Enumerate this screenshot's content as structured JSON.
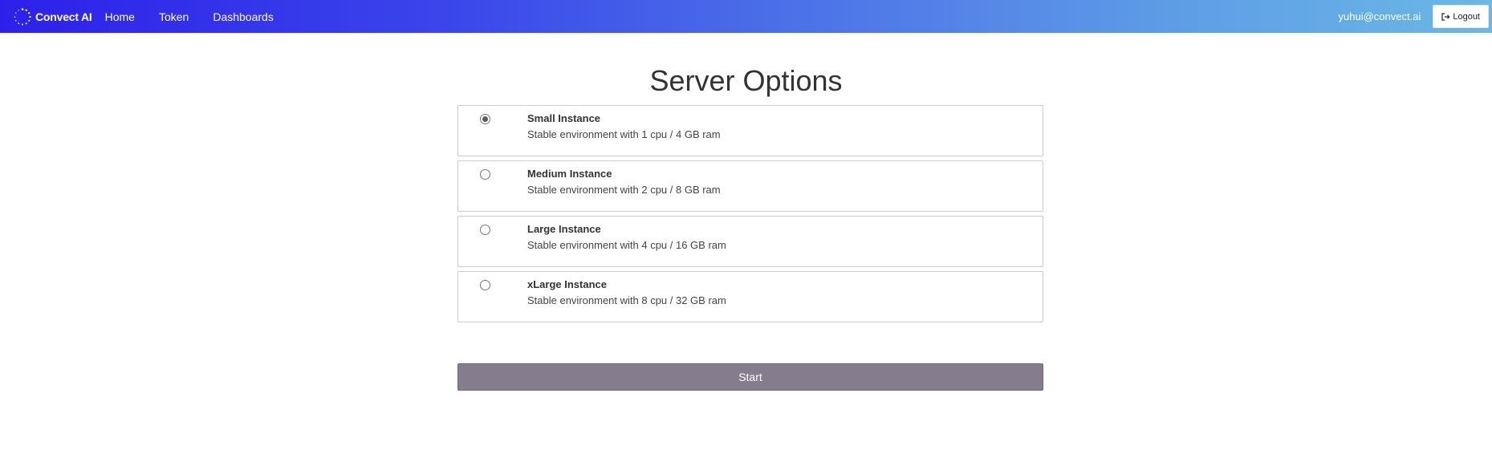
{
  "navbar": {
    "brand": "Convect AI",
    "links": [
      "Home",
      "Token",
      "Dashboards"
    ],
    "user_email": "yuhui@convect.ai",
    "logout_label": "Logout",
    "icons": {
      "brand": "spinner-logo-icon",
      "logout": "sign-out-icon"
    }
  },
  "main": {
    "title": "Server Options",
    "options": [
      {
        "name": "Small Instance",
        "description": "Stable environment with 1 cpu / 4 GB ram",
        "selected": true
      },
      {
        "name": "Medium Instance",
        "description": "Stable environment with 2 cpu / 8 GB ram",
        "selected": false
      },
      {
        "name": "Large Instance",
        "description": "Stable environment with 4 cpu / 16 GB ram",
        "selected": false
      },
      {
        "name": "xLarge Instance",
        "description": "Stable environment with 8 cpu / 32 GB ram",
        "selected": false
      }
    ],
    "start_label": "Start"
  },
  "colors": {
    "navbar_gradient_start": "#2d20ea",
    "navbar_gradient_end": "#6ab8e6",
    "start_button": "#857d8e",
    "option_border": "#cccccc"
  }
}
